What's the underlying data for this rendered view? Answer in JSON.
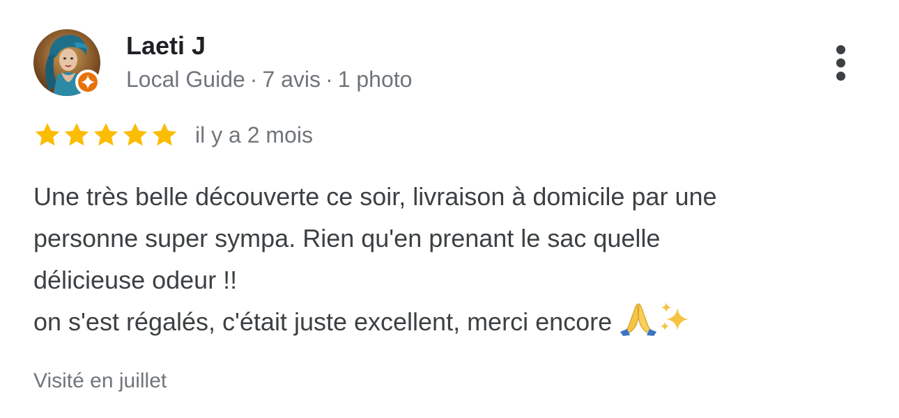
{
  "review": {
    "author": {
      "name": "Laeti J",
      "badge": "Local Guide",
      "review_count": "7 avis",
      "photo_count": "1 photo",
      "separator": "·",
      "avatar_icon": "profile-photo",
      "badge_icon": "local-guide-star-icon"
    },
    "menu_icon": "more-vert-icon",
    "rating": {
      "stars": 5,
      "max_stars": 5,
      "time_ago": "il y a 2 mois",
      "star_color": "#fbbc04"
    },
    "text_lines": [
      "Une très belle découverte ce soir, livraison à domicile par une",
      "personne super sympa. Rien qu'en prenant le sac quelle",
      "délicieuse odeur !!",
      "on s'est régalés, c'était juste excellent, merci encore"
    ],
    "emojis": [
      "🙏",
      "✨"
    ],
    "visited": "Visité en juillet"
  },
  "colors": {
    "name": "#202124",
    "secondary": "#70757a",
    "body": "#3c4043",
    "badge": "#e8710a"
  }
}
